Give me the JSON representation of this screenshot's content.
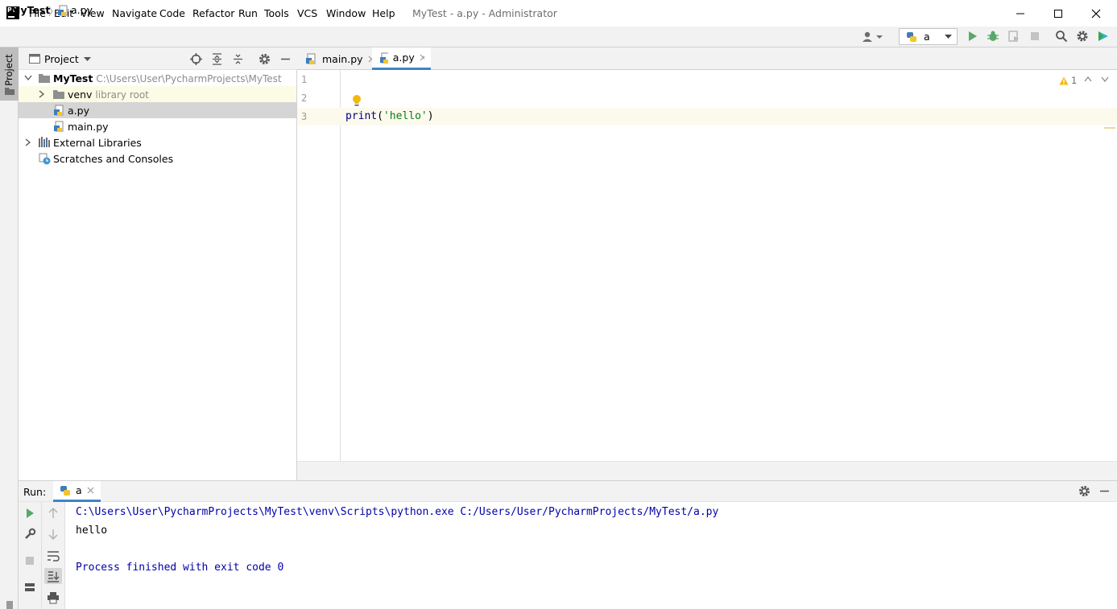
{
  "window": {
    "title": "MyTest - a.py - Administrator",
    "logo_text": "PC",
    "menu": [
      "File",
      "Edit",
      "View",
      "Navigate",
      "Code",
      "Refactor",
      "Run",
      "Tools",
      "VCS",
      "Window",
      "Help"
    ]
  },
  "breadcrumb": {
    "project": "MyTest",
    "separator": "〉",
    "file": "a.py"
  },
  "run_config": {
    "selected": "a"
  },
  "side_strip": {
    "project_label": "Project"
  },
  "project_panel": {
    "title": "Project",
    "tree": [
      {
        "label": "MyTest",
        "sub": "C:\\Users\\User\\PycharmProjects\\MyTest",
        "icon": "folder-icon",
        "expanded": true
      },
      {
        "label": "venv",
        "sub": "library root",
        "icon": "folder-icon",
        "expanded": false
      },
      {
        "label": "a.py",
        "sub": "",
        "icon": "python-file-icon",
        "selected": true
      },
      {
        "label": "main.py",
        "sub": "",
        "icon": "python-file-icon"
      },
      {
        "label": "External Libraries",
        "sub": "",
        "icon": "libraries-icon",
        "expanded": false
      },
      {
        "label": "Scratches and Consoles",
        "sub": "",
        "icon": "scratches-icon"
      }
    ]
  },
  "editor": {
    "tabs": [
      {
        "label": "main.py",
        "active": false
      },
      {
        "label": "a.py",
        "active": true
      }
    ],
    "line_numbers": [
      "1",
      "2",
      "3"
    ],
    "code": {
      "func": "print",
      "open": "(",
      "string": "'hello'",
      "close": ")"
    },
    "inspection_count": "1"
  },
  "run_panel": {
    "label": "Run:",
    "tab": "a",
    "console": [
      "C:\\Users\\User\\PycharmProjects\\MyTest\\venv\\Scripts\\python.exe C:/Users/User/PycharmProjects/MyTest/a.py",
      "hello",
      "",
      "Process finished with exit code 0"
    ]
  },
  "colors": {
    "accent": "#4083c9",
    "run_green": "#59a869",
    "console_blue": "#0000aa",
    "string_green": "#067d17",
    "func_navy": "#000080",
    "selection_gray": "#d5d5d5",
    "venv_highlight": "#fcfce6"
  }
}
